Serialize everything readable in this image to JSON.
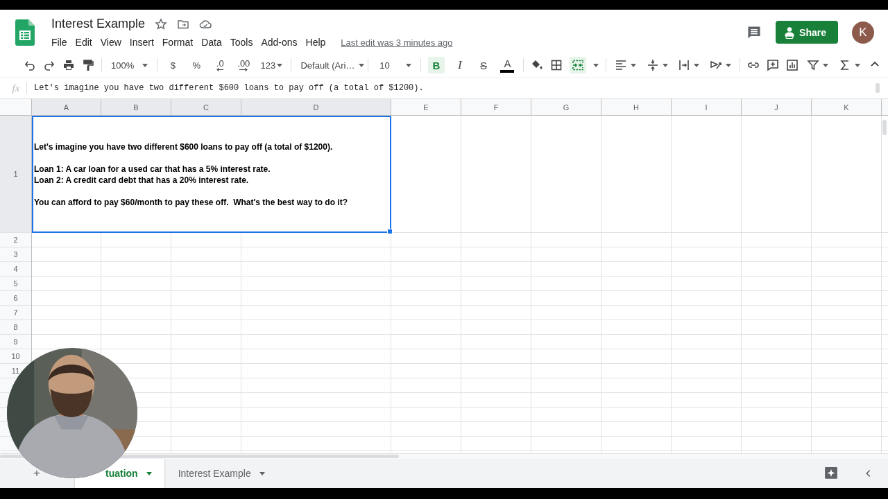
{
  "header": {
    "title": "Interest Example",
    "menu": [
      "File",
      "Edit",
      "View",
      "Insert",
      "Format",
      "Data",
      "Tools",
      "Add-ons",
      "Help"
    ],
    "last_edit": "Last edit was 3 minutes ago",
    "share": "Share",
    "avatar": "K"
  },
  "toolbar": {
    "zoom": "100%",
    "currency": "$",
    "percent": "%",
    "decimals_less": ".0",
    "decimals_more": ".00",
    "formats": "123",
    "font": "Default (Ari…",
    "font_size": "10",
    "bold": {
      "label": "B",
      "on": true
    },
    "italic": {
      "label": "I",
      "on": false
    },
    "strike": {
      "label": "S",
      "on": false
    },
    "text_color": {
      "label": "A",
      "color": "#000000"
    },
    "merge": {
      "on": true
    }
  },
  "formula_bar": {
    "label": "fx",
    "value": "Let's imagine you have two different $600 loans to pay off (a total of $1200)."
  },
  "grid": {
    "columns": [
      "A",
      "B",
      "C",
      "D",
      "E",
      "F",
      "G",
      "H",
      "I",
      "J",
      "K"
    ],
    "rows": [
      "1",
      "2",
      "3",
      "4",
      "5",
      "6",
      "7",
      "8",
      "9",
      "10",
      "11"
    ],
    "cell_a1": {
      "text": "Let's imagine you have two different $600 loans to pay off (a total of $1200).\n\nLoan 1: A car loan for a used car that has a 5% interest rate.\nLoan 2: A credit card debt that has a 20% interest rate.\n\nYou can afford to pay $60/month to pay these off.  What's the best way to do it?",
      "selected": true
    }
  },
  "sheets": {
    "add": "+",
    "tabs": [
      {
        "label": "tuation",
        "selected": true
      },
      {
        "label": "Interest Example",
        "selected": false
      }
    ]
  }
}
